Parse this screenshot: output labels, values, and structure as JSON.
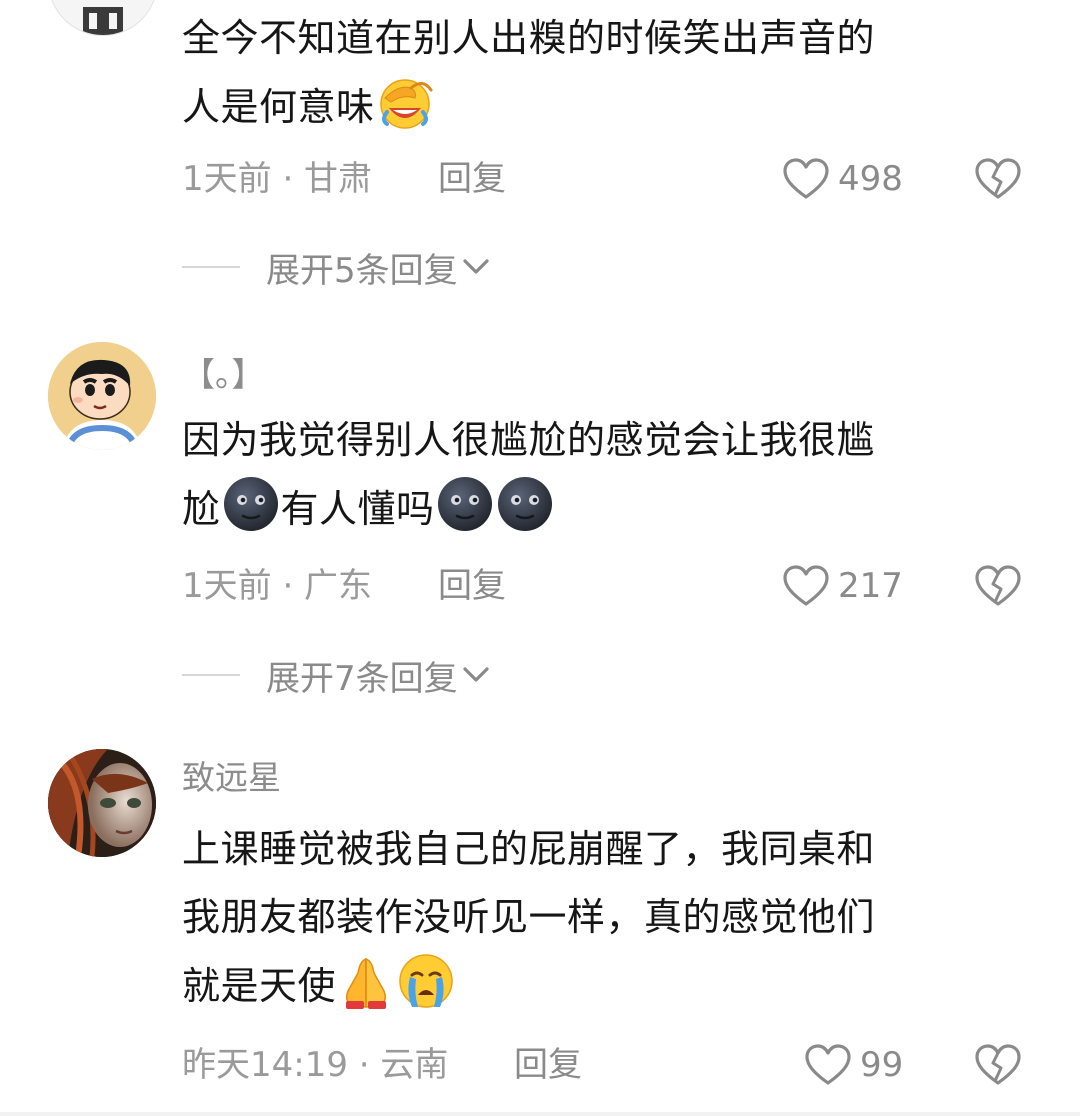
{
  "comments": [
    {
      "username": "",
      "lines": [
        "全今不知道在别人出糗的时候笑出声音的",
        "人是何意味"
      ],
      "emoji_after_line2": [
        "facepalm-laugh-emoji"
      ],
      "time_location": "1天前 · 甘肃",
      "reply_label": "回复",
      "likes": "498",
      "expand_label": "展开5条回复"
    },
    {
      "username": "【。】",
      "lines": [
        "因为我觉得别人很尴尬的感觉会让我很尴",
        "尬",
        "有人懂吗"
      ],
      "time_location": "1天前 · 广东",
      "reply_label": "回复",
      "likes": "217",
      "expand_label": "展开7条回复"
    },
    {
      "username": "致远星",
      "lines": [
        "上课睡觉被我自己的屁崩醒了，我同桌和",
        "我朋友都装作没听见一样，真的感觉他们",
        "就是天使"
      ],
      "time_location": "昨天14:19 · 云南",
      "reply_label": "回复",
      "likes": "99"
    }
  ],
  "colors": {
    "text_primary": "#161616",
    "text_secondary": "#8a8a8a",
    "divider": "#d6d6d6"
  }
}
